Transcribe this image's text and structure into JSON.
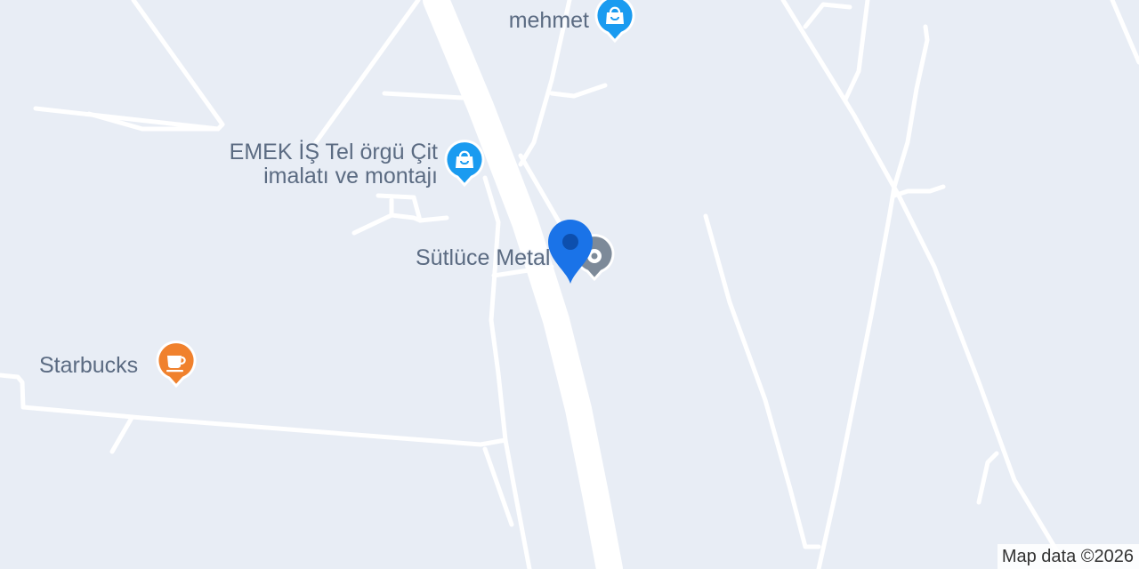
{
  "map": {
    "background_color": "#e8edf5",
    "road_color": "#ffffff",
    "pois": [
      {
        "id": "mehmet",
        "name": "mehmet",
        "icon": "shopping-bag-icon",
        "color": "#1a9bf0"
      },
      {
        "id": "emek",
        "name": "EMEK İŞ Tel örgü Çit imalatı ve montajı",
        "name_line1": "EMEK İŞ Tel örgü Çit",
        "name_line2": "imalatı ve montajı",
        "icon": "shopping-bag-icon",
        "color": "#1a9bf0"
      },
      {
        "id": "sutluce",
        "name": "Sütlüce Metal",
        "icon": "generic-place-icon",
        "color": "#7d8a99"
      },
      {
        "id": "starbucks",
        "name": "Starbucks",
        "icon": "coffee-cup-icon",
        "color": "#f0812d"
      }
    ],
    "selected_pin": {
      "icon": "location-pin-icon",
      "color": "#1a73e8"
    },
    "attribution": "Map data ©2026"
  }
}
